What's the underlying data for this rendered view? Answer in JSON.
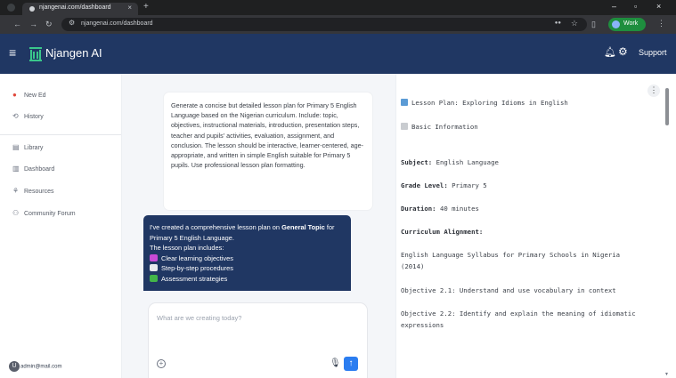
{
  "browser": {
    "tab_title": "njangenai.com/dashboard",
    "tab_close": "×",
    "new_tab": "+",
    "url": "njangenai.com/dashboard",
    "profile_label": "Work",
    "window_min": "–",
    "window_max": "▫",
    "window_close": "×"
  },
  "app": {
    "brand": "Njangen AI",
    "support": "Support"
  },
  "sidebar": {
    "items": [
      {
        "label": "New Ed",
        "icon": "plus-circle-icon"
      },
      {
        "label": "History",
        "icon": "history-icon"
      },
      {
        "label": "Library",
        "icon": "library-icon"
      },
      {
        "label": "Dashboard",
        "icon": "dashboard-icon"
      },
      {
        "label": "Resources",
        "icon": "resources-icon"
      },
      {
        "label": "Community Forum",
        "icon": "community-icon"
      }
    ],
    "user_initial": "U",
    "user_email": "admin@mail.com"
  },
  "chat": {
    "user_message": "Generate a concise but detailed lesson plan for Primary 5 English Language based on the Nigerian curriculum. Include: topic, objectives, instructional materials, introduction, presentation steps, teacher and pupils' activities, evaluation, assignment, and conclusion. The lesson should be interactive, learner-centered, age-appropriate, and written in simple English suitable for Primary 5 pupils. Use professional lesson plan formatting.",
    "ai_intro_pre": "I've created a comprehensive lesson plan on ",
    "ai_intro_bold": "General Topic",
    "ai_intro_post": " for Primary 5 English Language.",
    "ai_includes": "The lesson plan includes:",
    "ai_items": [
      "Clear learning objectives",
      "Step-by-step procedures",
      "Assessment strategies"
    ],
    "input_placeholder": "What are we creating today?"
  },
  "lesson_panel": {
    "title": "Lesson Plan: Exploring Idioms in English",
    "section": "Basic Information",
    "subject_label": "Subject:",
    "subject_value": "English Language",
    "grade_label": "Grade Level:",
    "grade_value": "Primary 5",
    "duration_label": "Duration:",
    "duration_value": "40 minutes",
    "alignment_label": "Curriculum Alignment:",
    "alignment_line1": "English Language Syllabus for Primary Schools in Nigeria",
    "alignment_line2": "(2014)",
    "objective1": "Objective 2.1: Understand and use vocabulary in context",
    "objective2_line1": "Objective 2.2: Identify and explain the meaning of idiomatic",
    "objective2_line2": "expressions"
  },
  "colors": {
    "header": "#203763",
    "send_button": "#2b7df0",
    "new_chat_icon": "#e0473b"
  }
}
